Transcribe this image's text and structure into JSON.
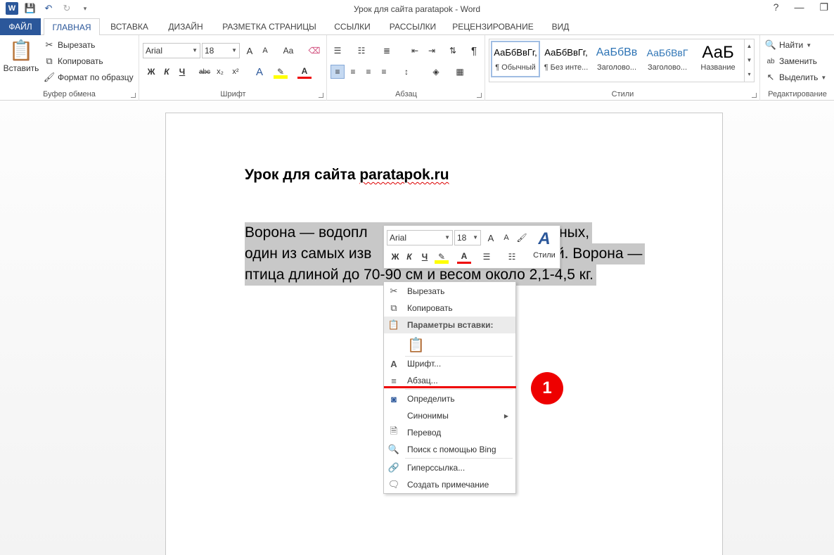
{
  "window": {
    "title": "Урок для сайта paratapok - Word",
    "help": "?",
    "minimize": "—",
    "restore": "❐"
  },
  "tabs": [
    "ФАЙЛ",
    "ГЛАВНАЯ",
    "ВСТАВКА",
    "ДИЗАЙН",
    "РАЗМЕТКА СТРАНИЦЫ",
    "ССЫЛКИ",
    "РАССЫЛКИ",
    "РЕЦЕНЗИРОВАНИЕ",
    "ВИД"
  ],
  "ribbon": {
    "clipboard": {
      "label": "Буфер обмена",
      "paste": "Вставить",
      "cut": "Вырезать",
      "copy": "Копировать",
      "format_painter": "Формат по образцу"
    },
    "font": {
      "label": "Шрифт",
      "font_name": "Arial",
      "font_size": "18",
      "grow": "A",
      "shrink": "A",
      "case": "Aa",
      "bold": "Ж",
      "italic": "К",
      "underline": "Ч",
      "strike": "abc",
      "sub": "x₂",
      "sup": "x²",
      "effects": "A",
      "color": "A"
    },
    "paragraph": {
      "label": "Абзац",
      "pilcrow": "¶"
    },
    "styles": {
      "label": "Стили",
      "items": [
        {
          "sample": "АаБбВвГг,",
          "name": "¶ Обычный"
        },
        {
          "sample": "АаБбВвГг,",
          "name": "¶ Без инте..."
        },
        {
          "sample": "АаБбВв",
          "name": "Заголово..."
        },
        {
          "sample": "АаБбВвГ",
          "name": "Заголово..."
        },
        {
          "sample": "АаБ",
          "name": "Название"
        }
      ]
    },
    "editing": {
      "label": "Редактирование",
      "find": "Найти",
      "replace": "Заменить",
      "select": "Выделить"
    }
  },
  "document": {
    "title_plain": "Урок для сайта ",
    "title_site": "paratapok.ru",
    "lines": [
      "Ворона — водопл",
      "ства утиных,",
      "один из самых изв",
      "усей. Ворона —",
      "птица длиной до 70-90 см и весом около 2,1-4,5 кг."
    ]
  },
  "mini_toolbar": {
    "font_name": "Arial",
    "font_size": "18",
    "bold": "Ж",
    "italic": "К",
    "underline": "Ч",
    "styles": "Стили"
  },
  "context_menu": {
    "cut": "Вырезать",
    "copy": "Копировать",
    "paste_options": "Параметры вставки:",
    "font": "Шрифт...",
    "paragraph": "Абзац...",
    "define": "Определить",
    "synonyms": "Синонимы",
    "translate": "Перевод",
    "bing_search": "Поиск с помощью Bing",
    "hyperlink": "Гиперссылка...",
    "new_comment": "Создать примечание"
  },
  "annotation": {
    "badge": "1",
    "color": "#e00000"
  },
  "colors": {
    "accent": "#2b579a",
    "selection": "#c8c8c8"
  }
}
